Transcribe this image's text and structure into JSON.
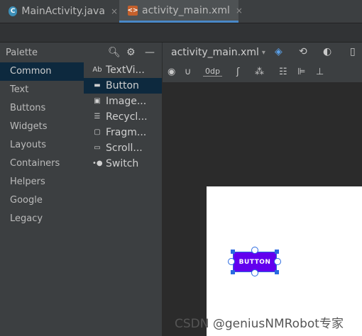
{
  "editor_tabs": [
    {
      "label": "MainActivity.java",
      "icon": "java-class-icon",
      "close": "×"
    },
    {
      "label": "activity_main.xml",
      "icon": "xml-layout-icon",
      "close": "×"
    }
  ],
  "palette": {
    "title": "Palette",
    "categories": [
      "Common",
      "Text",
      "Buttons",
      "Widgets",
      "Layouts",
      "Containers",
      "Helpers",
      "Google",
      "Legacy"
    ],
    "selected_category": "Common",
    "components": [
      {
        "icon": "Ab",
        "label": "TextVi..."
      },
      {
        "icon": "▬",
        "label": "Button"
      },
      {
        "icon": "▣",
        "label": "Image..."
      },
      {
        "icon": "☰",
        "label": "Recycl..."
      },
      {
        "icon": "▢",
        "label": "Fragm..."
      },
      {
        "icon": "▭",
        "label": "Scroll..."
      },
      {
        "icon": "•●",
        "label": "Switch"
      }
    ],
    "selected_component": "Button"
  },
  "design_toolbar": {
    "file_name": "activity_main.xml",
    "default_margin": "0dp"
  },
  "preview": {
    "button_label": "BUTTON",
    "button_color": "#6200ee"
  },
  "watermark": "CSDN @geniusNMRobot专家"
}
